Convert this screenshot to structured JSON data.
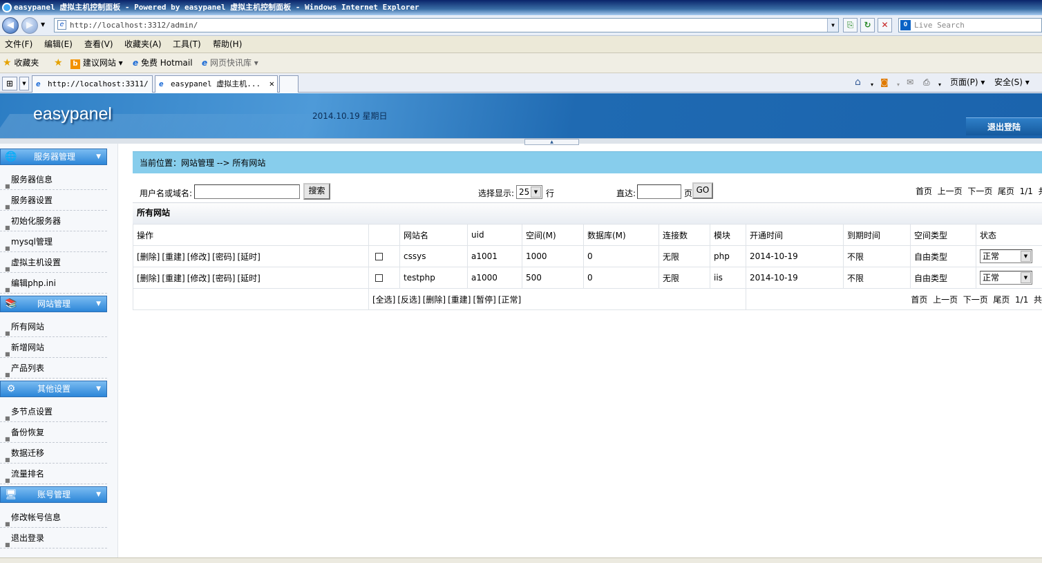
{
  "window": {
    "title": "easypanel 虚拟主机控制面板 - Powered by easypanel 虚拟主机控制面板 - Windows Internet Explorer"
  },
  "navbar": {
    "back_glyph": "◀",
    "forward_glyph": "▶",
    "address": "http://localhost:3312/admin/",
    "live_search_placeholder": "Live Search",
    "refresh_glyph": "↻",
    "stop_glyph": "✕",
    "compat_glyph": "⎘"
  },
  "menubar": {
    "items": [
      "文件(F)",
      "编辑(E)",
      "查看(V)",
      "收藏夹(A)",
      "工具(T)",
      "帮助(H)"
    ]
  },
  "favbar": {
    "favorites": "收藏夹",
    "suggested": "建议网站",
    "hotmail": "免费 Hotmail",
    "webslice": "网页快讯库"
  },
  "tabs": {
    "items": [
      {
        "label": "http://localhost:3311/"
      },
      {
        "label": "easypanel 虚拟主机..."
      }
    ],
    "close_glyph": "✕",
    "tools": {
      "page": "页面(P)",
      "safety": "安全(S)"
    }
  },
  "header": {
    "brand": "easypanel",
    "date": "2014.10.19 星期日",
    "logout": "退出登陆"
  },
  "sidebar": {
    "groups": [
      {
        "label": "服务器管理",
        "icon": "server-icon",
        "items": [
          "服务器信息",
          "服务器设置",
          "初始化服务器",
          "mysql管理",
          "虚拟主机设置",
          "编辑php.ini"
        ]
      },
      {
        "label": "网站管理",
        "icon": "website-icon",
        "items": [
          "所有网站",
          "新增网站",
          "产品列表"
        ]
      },
      {
        "label": "其他设置",
        "icon": "settings-icon",
        "items": [
          "多节点设置",
          "备份恢复",
          "数据迁移",
          "流量排名"
        ]
      },
      {
        "label": "账号管理",
        "icon": "account-icon",
        "items": [
          "修改帐号信息",
          "退出登录"
        ]
      }
    ]
  },
  "main": {
    "breadcrumb": "当前位置：网站管理 --> 所有网站",
    "search": {
      "label": "用户名或域名:",
      "value": "",
      "button": "搜索"
    },
    "page_size": {
      "label": "选择显示:",
      "value": "25",
      "unit": "行"
    },
    "goto": {
      "label": "直达:",
      "value": "",
      "unit": "页",
      "button": "GO"
    },
    "pagination": {
      "first": "首页",
      "prev": "上一页",
      "next": "下一页",
      "last": "尾页",
      "pages": "1/1",
      "total": "共"
    },
    "section_title": "所有网站",
    "columns": [
      "操作",
      "",
      "网站名",
      "uid",
      "空间(M)",
      "数据库(M)",
      "连接数",
      "模块",
      "开通时间",
      "到期时间",
      "空间类型",
      "状态"
    ],
    "row_ops": [
      "[删除]",
      "[重建]",
      "[修改]",
      "[密码]",
      "[延时]"
    ],
    "rows": [
      {
        "name": "cssys",
        "uid": "a1001",
        "space": "1000",
        "db": "0",
        "conn": "无限",
        "module": "php",
        "open": "2014-10-19",
        "expire": "不限",
        "type": "自由类型",
        "status": "正常"
      },
      {
        "name": "testphp",
        "uid": "a1000",
        "space": "500",
        "db": "0",
        "conn": "无限",
        "module": "iis",
        "open": "2014-10-19",
        "expire": "不限",
        "type": "自由类型",
        "status": "正常"
      }
    ],
    "bulk_ops": [
      "[全选]",
      "[反选]",
      "[删除]",
      "[重建]",
      "[暂停]",
      "[正常]"
    ]
  }
}
